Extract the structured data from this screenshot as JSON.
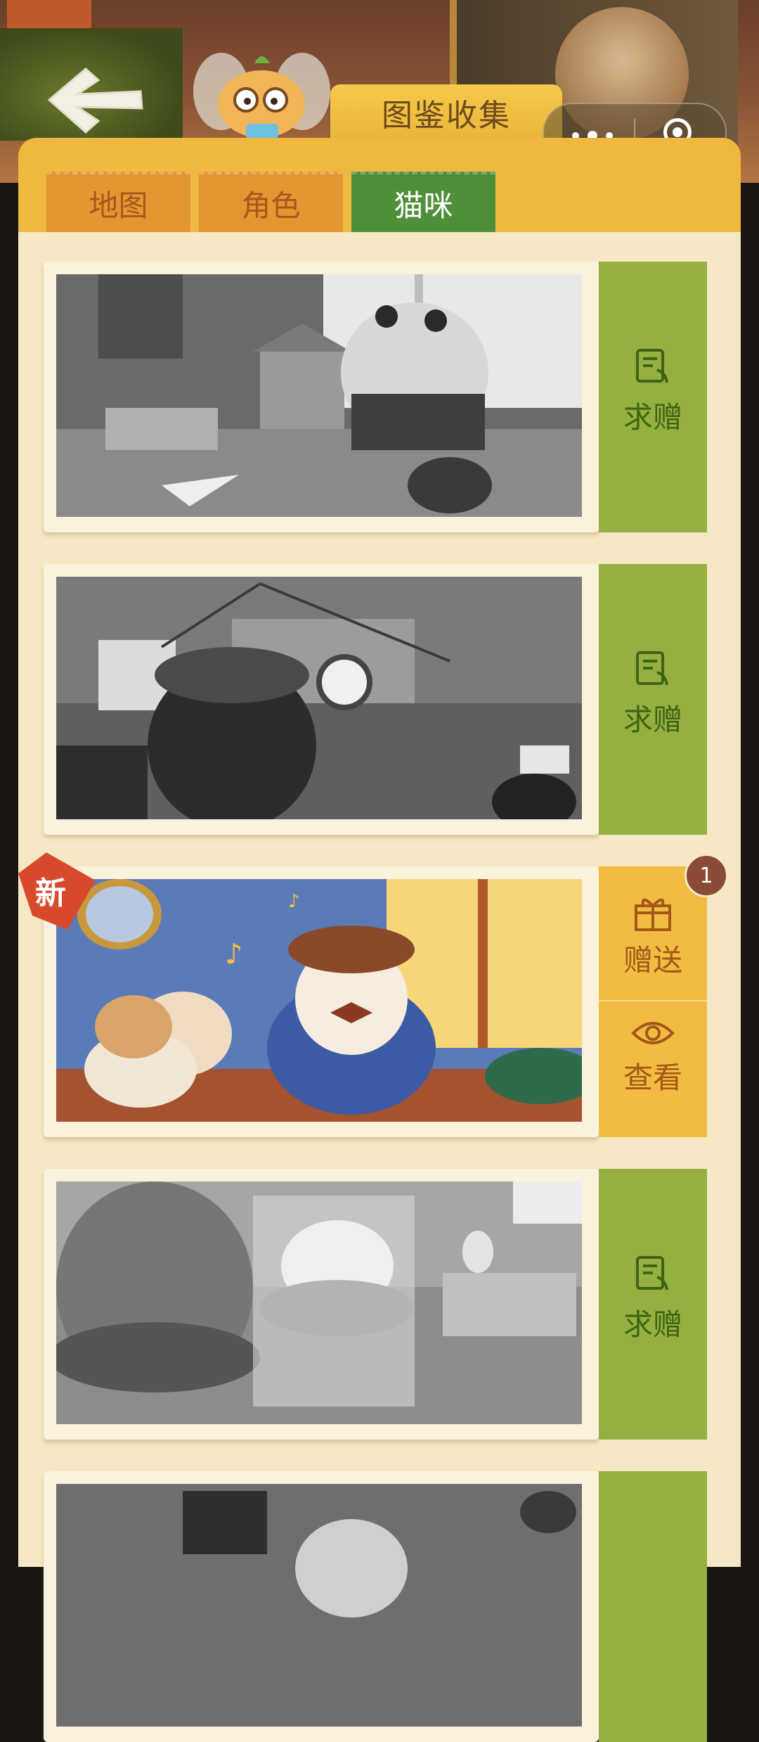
{
  "header": {
    "title": "图鉴收集"
  },
  "tabs": [
    {
      "label": "地图",
      "active": false
    },
    {
      "label": "角色",
      "active": false
    },
    {
      "label": "猫咪",
      "active": true
    }
  ],
  "cards": [
    {
      "state": "locked",
      "action_label": "求赠",
      "action_icon": "request-icon"
    },
    {
      "state": "locked",
      "action_label": "求赠",
      "action_icon": "request-icon"
    },
    {
      "state": "owned",
      "new_tag": "新",
      "badge_count": "1",
      "gift_label": "赠送",
      "view_label": "查看"
    },
    {
      "state": "locked",
      "action_label": "求赠",
      "action_icon": "request-icon"
    },
    {
      "state": "locked"
    }
  ],
  "colors": {
    "panel": "#eeb93e",
    "active_tab": "#4f8f3a",
    "inactive_tab": "#e39632",
    "request_green": "#95b040",
    "gift_yellow": "#f2bc42",
    "content_bg": "#f6e8c4"
  }
}
